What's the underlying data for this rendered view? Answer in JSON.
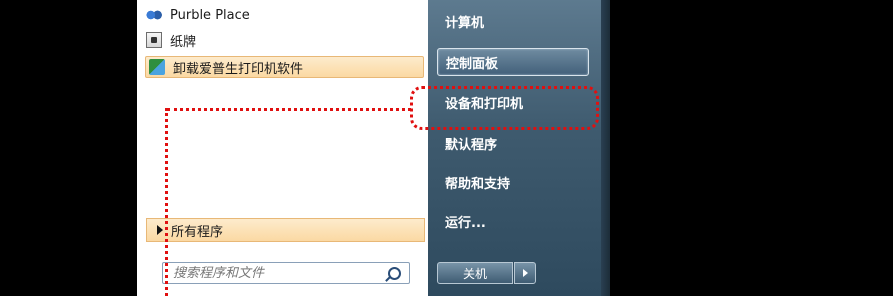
{
  "programs": [
    {
      "label": "Purble Place",
      "icon": "purble-place-icon"
    },
    {
      "label": "纸牌",
      "icon": "solitaire-icon"
    },
    {
      "label": "卸载爱普生打印机软件",
      "icon": "uninstall-icon",
      "highlighted": true
    }
  ],
  "all_programs": {
    "label": "所有程序"
  },
  "search": {
    "placeholder": "搜索程序和文件"
  },
  "right_items": [
    {
      "label": "计算机"
    },
    {
      "label": "控制面板",
      "active": true
    },
    {
      "label": "设备和打印机",
      "annotated": true
    },
    {
      "label": "默认程序"
    },
    {
      "label": "帮助和支持"
    },
    {
      "label": "运行..."
    }
  ],
  "shutdown": {
    "label": "关机"
  },
  "colors": {
    "annotation": "#e01010",
    "highlight": "#fbd9a3",
    "right_pane": "#3e5a6e"
  }
}
